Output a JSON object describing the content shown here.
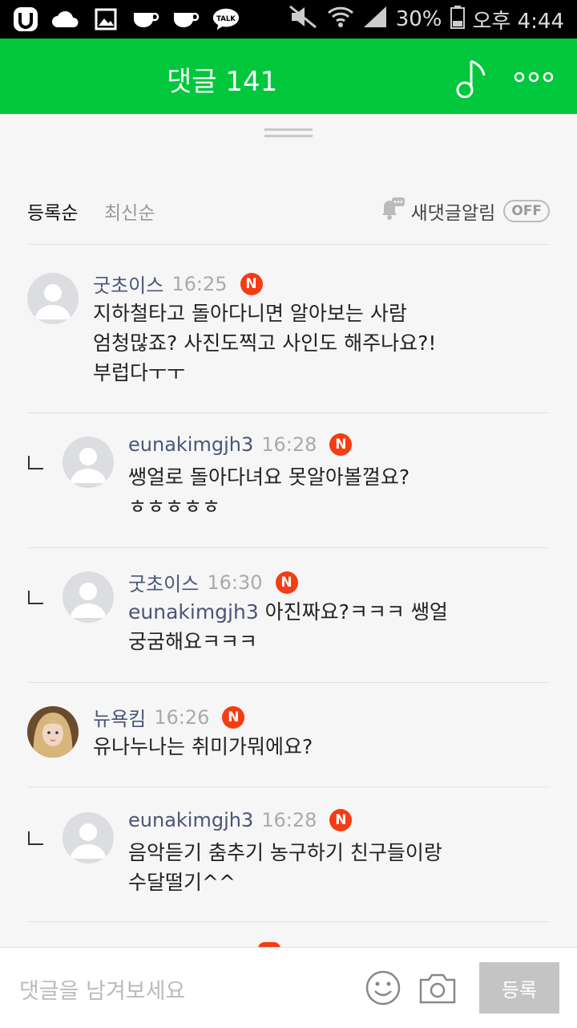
{
  "status_bar": {
    "battery": "30%",
    "time": "오후 4:44",
    "left_icons": [
      "u-icon",
      "cloud-icon",
      "image-icon",
      "cup-icon",
      "cup-icon",
      "talk-icon"
    ],
    "talk_label": "TALK"
  },
  "header": {
    "title": "댓글 141",
    "color": "#00c73c"
  },
  "sort": {
    "option1": "등록순",
    "option2": "최신순",
    "notify_label": "새댓글알림",
    "notify_toggle": "OFF"
  },
  "comments": [
    {
      "nick": "굿초이스",
      "time": "16:25",
      "badge": "N",
      "text": "지하철타고 돌아다니면 알아보는 사람\n엄청많죠? 사진도찍고 사인도 해주나요?!\n부럽다ㅜㅜ"
    },
    {
      "nick": "eunakimgjh3",
      "time": "16:28",
      "badge": "N",
      "text": "쌩얼로 돌아다녀요 못알아볼껄요?\nㅎㅎㅎㅎㅎ"
    },
    {
      "nick": "굿초이스",
      "time": "16:30",
      "badge": "N",
      "mention": "eunakimgjh3",
      "text": " 아진짜요?ㅋㅋㅋ 쌩얼\n궁굼해요ㅋㅋㅋ"
    },
    {
      "nick": "뉴욕킴",
      "time": "16:26",
      "badge": "N",
      "text": "유나누나는 취미가뭐에요?"
    },
    {
      "nick": "eunakimgjh3",
      "time": "16:28",
      "badge": "N",
      "text": "음악듣기 춤추기 농구하기 친구들이랑\n수달떨기^^"
    }
  ],
  "input": {
    "placeholder": "댓글을 남겨보세요",
    "submit_label": "등록"
  }
}
